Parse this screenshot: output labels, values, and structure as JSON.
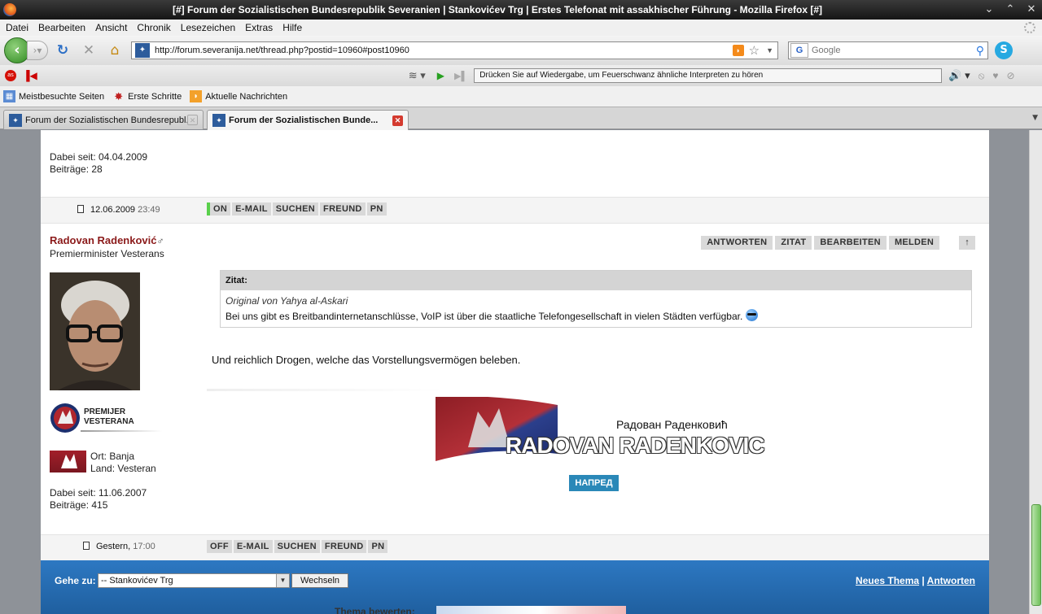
{
  "window": {
    "title": "[#] Forum der Sozialistischen Bundesrepublik Severanien | Stankovićev Trg | Erstes Telefonat mit assakhischer Führung - Mozilla Firefox [#]"
  },
  "menu": [
    "Datei",
    "Bearbeiten",
    "Ansicht",
    "Chronik",
    "Lesezeichen",
    "Extras",
    "Hilfe"
  ],
  "address": {
    "url": "http://forum.severanija.net/thread.php?postid=10960#post10960"
  },
  "search": {
    "placeholder": "Google"
  },
  "player": {
    "ticker": "Drücken Sie auf Wiedergabe, um Feuerschwanz ähnliche Interpreten zu hören"
  },
  "bookmarks": [
    "Meistbesuchte Seiten",
    "Erste Schritte",
    "Aktuelle Nachrichten"
  ],
  "tabs": [
    {
      "label": "Forum der Sozialistischen Bundesrepubl..."
    },
    {
      "label": "Forum der Sozialistischen Bunde..."
    }
  ],
  "post1": {
    "since": "Dabei seit: 04.04.2009",
    "posts": "Beiträge: 28",
    "date": "12.06.2009",
    "time": "23:49",
    "buttons": [
      "ON",
      "E-MAIL",
      "SUCHEN",
      "FREUND",
      "PN"
    ]
  },
  "post2": {
    "author": "Radovan Radenković",
    "gender_symbol": "♂",
    "rank": "Premierminister Vesterans",
    "actions": [
      "ANTWORTEN",
      "ZITAT",
      "BEARBEITEN",
      "MELDEN"
    ],
    "top": "↑",
    "rank_badge": {
      "line1": "PREMIJER",
      "line2": "VESTERANA"
    },
    "location": "Ort: Banja",
    "country": "Land: Vesteran",
    "since": "Dabei seit: 11.06.2007",
    "posts": "Beiträge: 415",
    "quote": {
      "header": "Zitat:",
      "author": "Original von Yahya al-Askari",
      "text": "Bei uns gibt es Breitbandinternetanschlüsse, VoIP ist über die staatliche Telefongesellschaft in vielen Städten verfügbar."
    },
    "message": "Und reichlich Drogen, welche das Vorstellungsvermögen beleben.",
    "signature": {
      "cyrillic": "Радован Раденковић",
      "latin": "RADOVAN RADENKOVIC",
      "badge": "НАПРЕД"
    },
    "date": "Gestern,",
    "time": "17:00",
    "buttons": [
      "OFF",
      "E-MAIL",
      "SUCHEN",
      "FREUND",
      "PN"
    ]
  },
  "footer": {
    "goto_label": "Gehe zu:",
    "goto_value": "-- Stankovićev Trg",
    "switch_button": "Wechseln",
    "new_topic": "Neues Thema",
    "separator": "|",
    "reply": "Antworten",
    "rate_label": "Thema bewerten:"
  }
}
